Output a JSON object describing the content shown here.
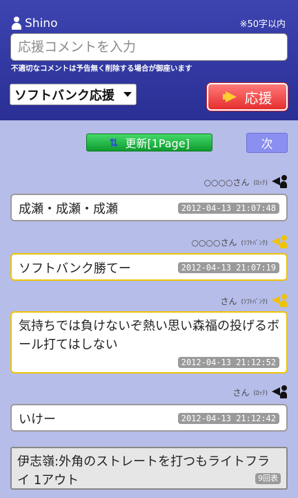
{
  "header": {
    "username": "Shino",
    "limit_note": "※50字以内",
    "comment_placeholder": "応援コメントを入力",
    "warning": "不適切なコメントは予告無く削除する場合が御座います",
    "team_select_value": "ソフトバンク応援",
    "cheer_label": "応援"
  },
  "nav": {
    "refresh_label": "更新[1Page]",
    "next_label": "次"
  },
  "comments": [
    {
      "user": "○○○○さん",
      "team": "(ﾛｯﾃ)",
      "text": "成瀬・成瀬・成瀬",
      "time": "2012-04-13 21:07:48",
      "side": "lotte"
    },
    {
      "user": "○○○○さん",
      "team": "(ｿﾌﾄﾊﾞﾝｸ)",
      "text": "ソフトバンク勝てー",
      "time": "2012-04-13 21:07:19",
      "side": "softbank"
    },
    {
      "user": "さん",
      "team": "(ｿﾌﾄﾊﾞﾝｸ)",
      "text": "気持ちでは負けないぞ熱い思い森福の投げるボール打てはしない",
      "time": "2012-04-13 21:12:52",
      "side": "softbank"
    },
    {
      "user": "さん",
      "team": "(ﾛｯﾃ)",
      "text": "いけー",
      "time": "2012-04-13 21:12:42",
      "side": "lotte"
    }
  ],
  "play": {
    "text": "伊志嶺:外角のストレートを打つもライトフライ 1アウト",
    "inning": "9回表"
  },
  "colors": {
    "lotte": "#111111",
    "softbank": "#f0c300"
  }
}
